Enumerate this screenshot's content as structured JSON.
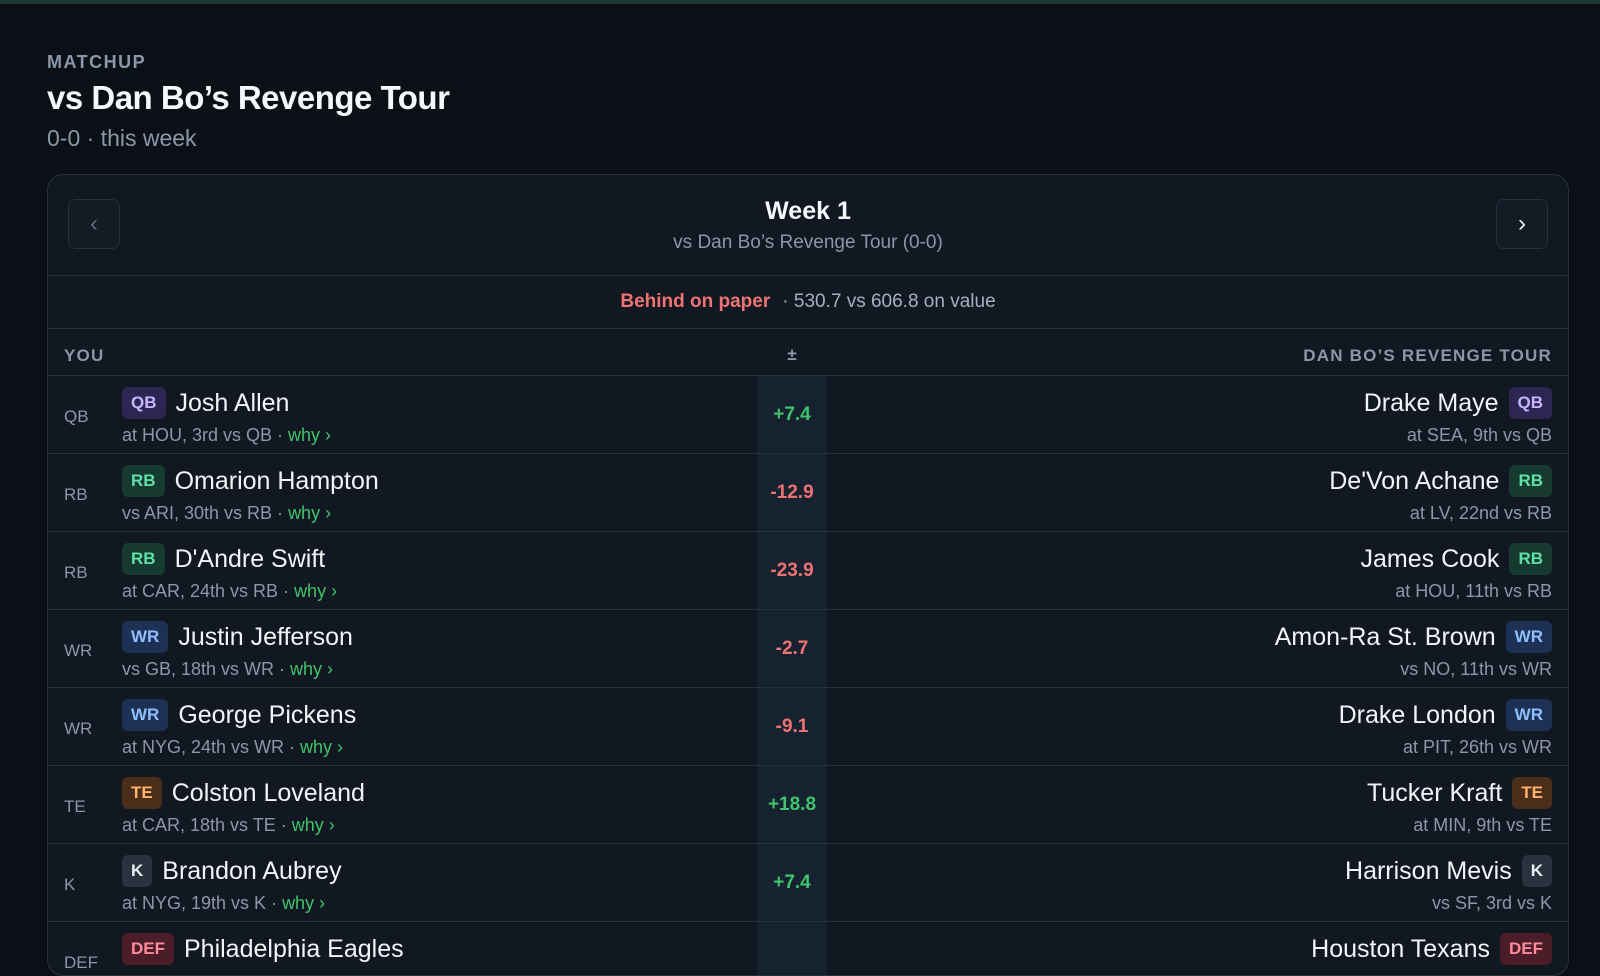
{
  "header": {
    "eyebrow": "MATCHUP",
    "title": "vs Dan Bo’s Revenge Tour",
    "subtitle": "0-0 · this week"
  },
  "week_nav": {
    "prev_icon": "chevron-left-icon",
    "prev_symbol": "‹",
    "next_icon": "chevron-right-icon",
    "next_symbol": "›",
    "title": "Week 1",
    "subtitle": "vs Dan Bo’s Revenge Tour (0-0)"
  },
  "summary": {
    "status": "Behind on paper",
    "text": "· 530.7 vs 606.8 on value"
  },
  "columns": {
    "you": "YOU",
    "delta": "±",
    "opponent": "DAN BO’S REVENGE TOUR"
  },
  "colors": {
    "positive": "#3fc46b",
    "negative": "#f07373",
    "background": "#0b1017",
    "card": "#111821"
  },
  "rows": [
    {
      "slot": "QB",
      "you": {
        "pos": "QB",
        "name": "Josh Allen",
        "meta": "at HOU, 3rd vs QB · ",
        "why": "why ›"
      },
      "delta": "+7.4",
      "delta_sign": "pos",
      "opp": {
        "pos": "QB",
        "name": "Drake Maye",
        "meta": "at SEA, 9th vs QB"
      }
    },
    {
      "slot": "RB",
      "you": {
        "pos": "RB",
        "name": "Omarion Hampton",
        "meta": "vs ARI, 30th vs RB · ",
        "why": "why ›"
      },
      "delta": "-12.9",
      "delta_sign": "neg",
      "opp": {
        "pos": "RB",
        "name": "De'Von Achane",
        "meta": "at LV, 22nd vs RB"
      }
    },
    {
      "slot": "RB",
      "you": {
        "pos": "RB",
        "name": "D'Andre Swift",
        "meta": "at CAR, 24th vs RB · ",
        "why": "why ›"
      },
      "delta": "-23.9",
      "delta_sign": "neg",
      "opp": {
        "pos": "RB",
        "name": "James Cook",
        "meta": "at HOU, 11th vs RB"
      }
    },
    {
      "slot": "WR",
      "you": {
        "pos": "WR",
        "name": "Justin Jefferson",
        "meta": "vs GB, 18th vs WR · ",
        "why": "why ›"
      },
      "delta": "-2.7",
      "delta_sign": "neg",
      "opp": {
        "pos": "WR",
        "name": "Amon-Ra St. Brown",
        "meta": "vs NO, 11th vs WR"
      }
    },
    {
      "slot": "WR",
      "you": {
        "pos": "WR",
        "name": "George Pickens",
        "meta": "at NYG, 24th vs WR · ",
        "why": "why ›"
      },
      "delta": "-9.1",
      "delta_sign": "neg",
      "opp": {
        "pos": "WR",
        "name": "Drake London",
        "meta": "at PIT, 26th vs WR"
      }
    },
    {
      "slot": "TE",
      "you": {
        "pos": "TE",
        "name": "Colston Loveland",
        "meta": "at CAR, 18th vs TE · ",
        "why": "why ›"
      },
      "delta": "+18.8",
      "delta_sign": "pos",
      "opp": {
        "pos": "TE",
        "name": "Tucker Kraft",
        "meta": "at MIN, 9th vs TE"
      }
    },
    {
      "slot": "K",
      "you": {
        "pos": "K",
        "name": "Brandon Aubrey",
        "meta": "at NYG, 19th vs K · ",
        "why": "why ›"
      },
      "delta": "+7.4",
      "delta_sign": "pos",
      "opp": {
        "pos": "K",
        "name": "Harrison Mevis",
        "meta": "vs SF, 3rd vs K"
      }
    },
    {
      "slot": "DEF",
      "you": {
        "pos": "DEF",
        "name": "Philadelphia Eagles",
        "meta": "",
        "why": ""
      },
      "delta": "",
      "delta_sign": "neg",
      "opp": {
        "pos": "DEF",
        "name": "Houston Texans",
        "meta": ""
      }
    }
  ]
}
